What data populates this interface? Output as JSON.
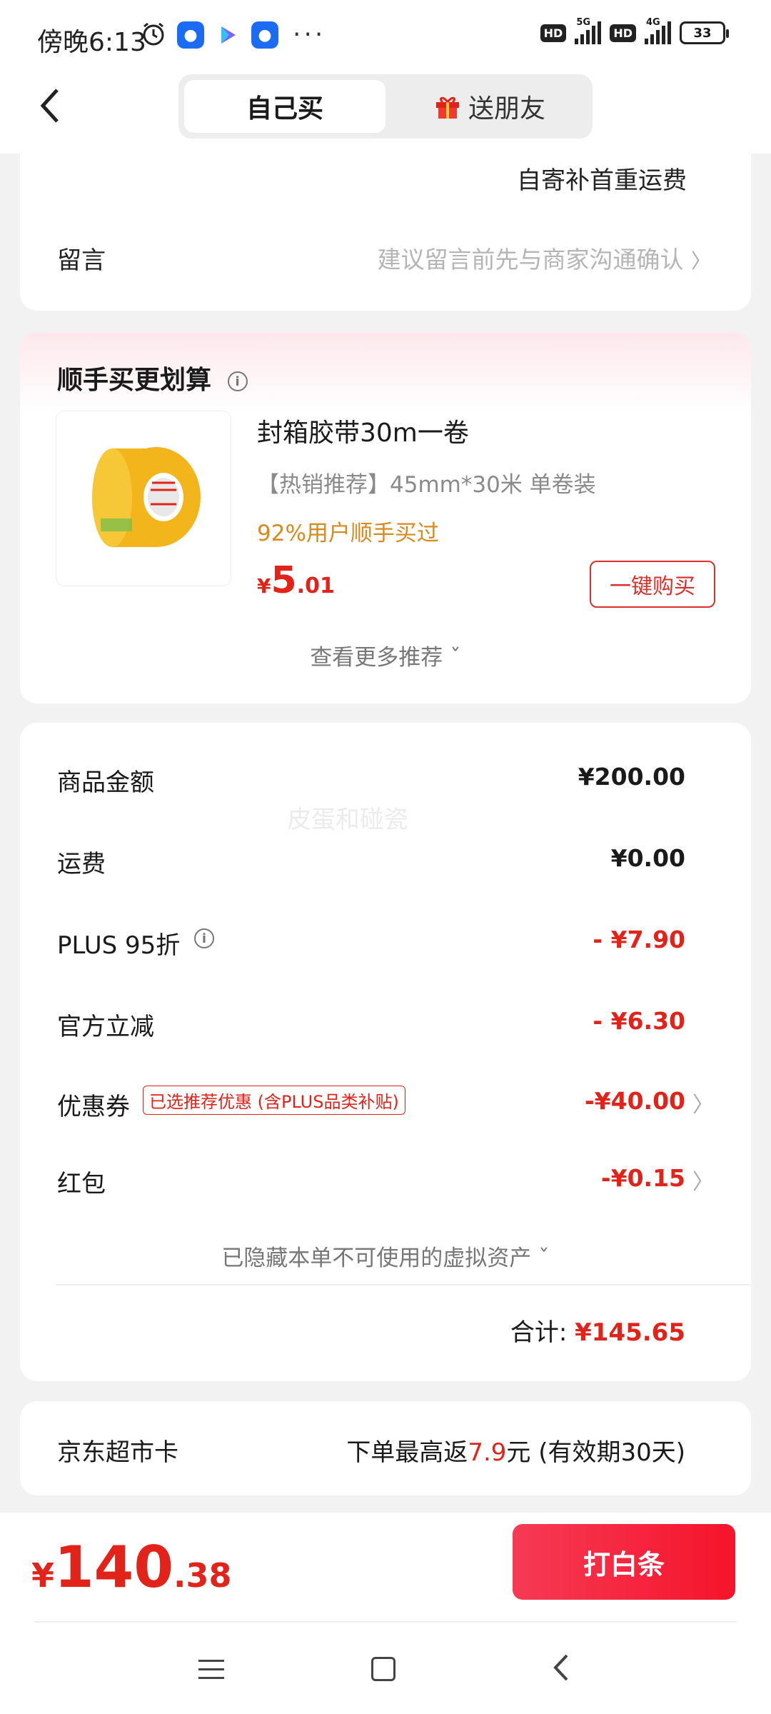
{
  "status_bar": {
    "time": "傍晚6:13",
    "network_1": "5G",
    "network_2": "4G",
    "hd_label": "HD",
    "battery": "33",
    "more": "···",
    "icons": [
      "alarm-icon",
      "app-icon-blue",
      "play-store-icon",
      "app-icon-blue-2"
    ]
  },
  "header": {
    "tab_self": "自己买",
    "tab_gift": "送朋友",
    "back_icon": "chevron-left-icon"
  },
  "shipping": {
    "note": "自寄补首重运费",
    "message_label": "留言",
    "message_hint": "建议留言前先与商家沟通确认",
    "arrow": "〉"
  },
  "recommend": {
    "title": "顺手买更划算",
    "product_name": "封箱胶带30m一卷",
    "product_spec": "【热销推荐】45mm*30米 单卷装",
    "social_proof": "92%用户顺手买过",
    "price_currency": "¥",
    "price_int": "5",
    "price_dec": ".01",
    "buy_label": "一键购买",
    "more_label": "查看更多推荐 ˇ"
  },
  "summary": {
    "rows": [
      {
        "label": "商品金额",
        "value": "¥200.00"
      },
      {
        "label": "运费",
        "value": "¥0.00"
      },
      {
        "label": "PLUS 95折",
        "value": "- ¥7.90"
      },
      {
        "label": "官方立减",
        "value": "- ¥6.30"
      },
      {
        "label": "优惠券",
        "value": "-¥40.00",
        "tag": "已选推荐优惠 (含PLUS品类补贴)"
      },
      {
        "label": "红包",
        "value": "-¥0.15"
      }
    ],
    "hidden_assets": "已隐藏本单不可使用的虚拟资产 ˇ",
    "total_label": "合计: ",
    "total_value": "¥145.65",
    "watermark": "皮蛋和碰瓷"
  },
  "supermarket_card": {
    "label": "京东超市卡",
    "text_prefix": "下单最高返",
    "highlight": "7.9",
    "text_suffix": "元 (有效期30天)"
  },
  "footer": {
    "pay_currency": "¥",
    "pay_int": "140",
    "pay_dec": ".38",
    "pay_button": "打白条"
  },
  "colors": {
    "accent_red": "#e2231a",
    "social_orange": "#d98a1e",
    "pay_button_gradient_start": "#f63a55",
    "pay_button_gradient_end": "#f5142b"
  }
}
